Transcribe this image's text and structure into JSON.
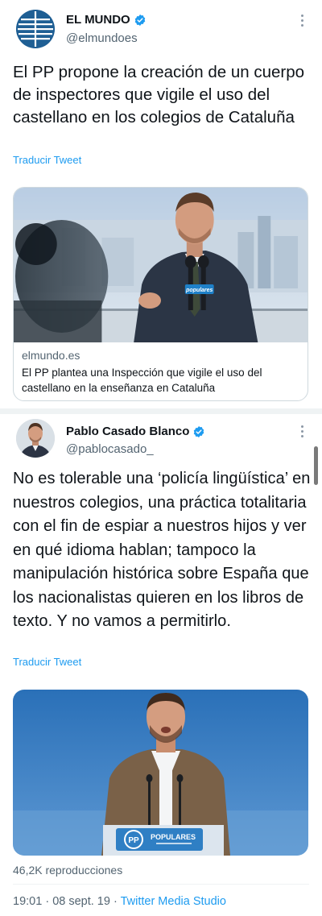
{
  "tweet1": {
    "display_name": "EL MUNDO",
    "handle": "@elmundoes",
    "text": "El PP propone la creación de un cuerpo de inspectores que vigile el uso del castellano en los colegios de Cataluña",
    "translate_label": "Traducir Tweet",
    "card": {
      "domain": "elmundo.es",
      "title": "El PP plantea una Inspección que vigile el uso del castellano en la enseñanza en Cataluña",
      "podium_label": "populares"
    }
  },
  "tweet2": {
    "display_name": "Pablo Casado Blanco",
    "handle": "@pablocasado_",
    "text": "No es tolerable una ‘policía lingüística’ en nuestros colegios, una práctica totalitaria con el fin de espiar a nuestros hijos y ver en qué idioma hablan; tampoco la manipulación histórica sobre España que los nacionalistas quieren en los libros de texto. Y no vamos a permitirlo.",
    "translate_label": "Traducir Tweet",
    "media": {
      "podium_logo": "PP",
      "podium_label": "POPULARES"
    },
    "views": "46,2K reproducciones",
    "time": "19:01",
    "date": "08 sept. 19",
    "source": "Twitter Media Studio"
  },
  "colors": {
    "verified": "#1d9bf0",
    "link": "#1d9bf0",
    "secondary_text": "#536471",
    "separator": "#eff3f4"
  },
  "icons": {
    "verified": "verified-badge-icon",
    "more": "more-options-icon"
  }
}
